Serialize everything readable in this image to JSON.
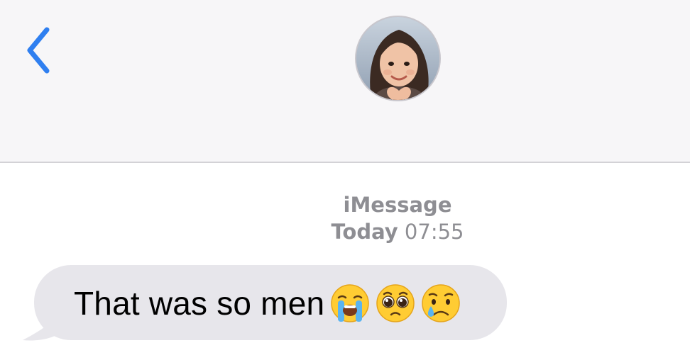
{
  "header": {
    "back_icon": "chevron-left-icon",
    "avatar_icon": "contact-avatar",
    "accent_color": "#2f7ff0"
  },
  "conversation": {
    "service": "iMessage",
    "day": "Today",
    "time": "07:55"
  },
  "messages": [
    {
      "direction": "incoming",
      "text": "That was so men",
      "emojis": [
        "loudly-crying-face-icon",
        "pleading-face-icon",
        "crying-face-icon"
      ],
      "bubble_color": "#e7e6eb"
    }
  ]
}
